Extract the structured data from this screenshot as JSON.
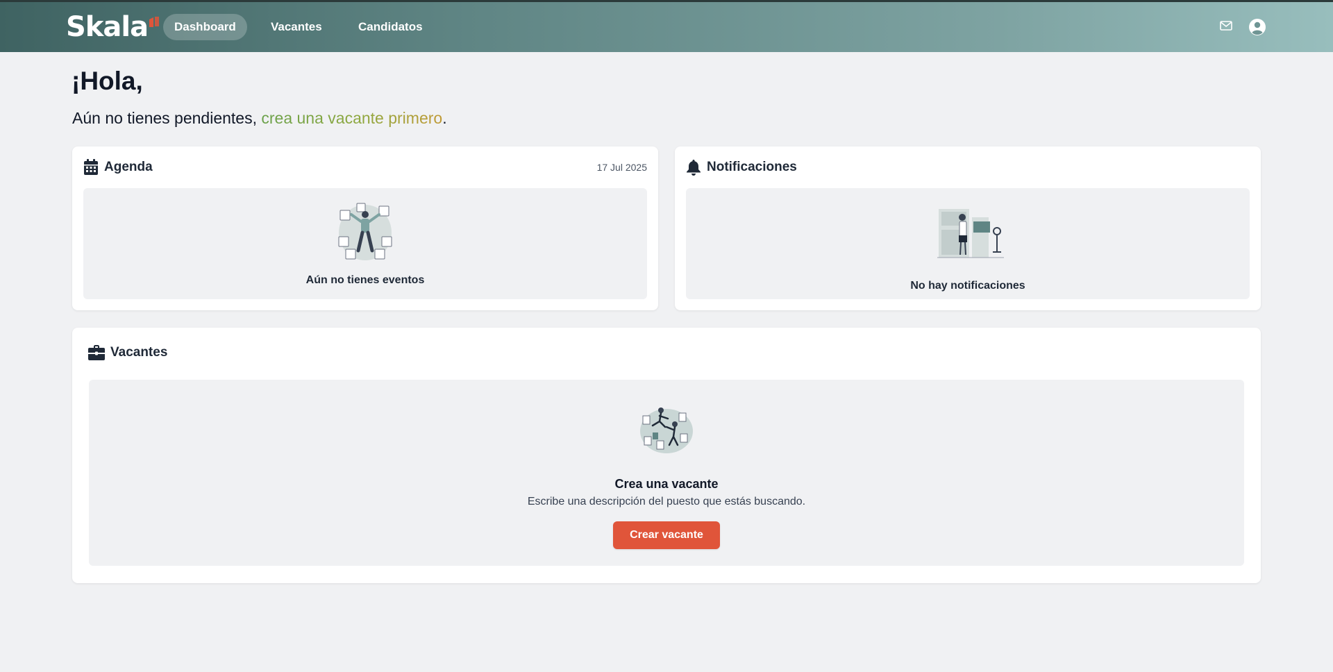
{
  "nav": {
    "logo_text": "Skala",
    "items": [
      {
        "label": "Dashboard",
        "active": true
      },
      {
        "label": "Vacantes",
        "active": false
      },
      {
        "label": "Candidatos",
        "active": false
      }
    ],
    "icons": [
      "mail-icon",
      "user-account-icon"
    ]
  },
  "greeting": {
    "title": "¡Hola,",
    "prefix": "Aún no tienes pendientes, ",
    "link": "crea una vacante primero",
    "suffix": "."
  },
  "agenda": {
    "title": "Agenda",
    "icon": "calendar-icon",
    "date": "17 Jul 2025",
    "empty_text": "Aún no tienes eventos"
  },
  "notifications": {
    "title": "Notificaciones",
    "icon": "bell-icon",
    "empty_text": "No hay notificaciones"
  },
  "vacancies": {
    "title": "Vacantes",
    "icon": "briefcase-icon",
    "cta_title": "Crea una vacante",
    "cta_description": "Escribe una descripción del puesto que estás buscando.",
    "cta_button": "Crear vacante"
  },
  "colors": {
    "brand_teal": "#5f8584",
    "accent_orange": "#e0553a",
    "link_green": "#6aa14a",
    "link_gold": "#c09a35"
  }
}
